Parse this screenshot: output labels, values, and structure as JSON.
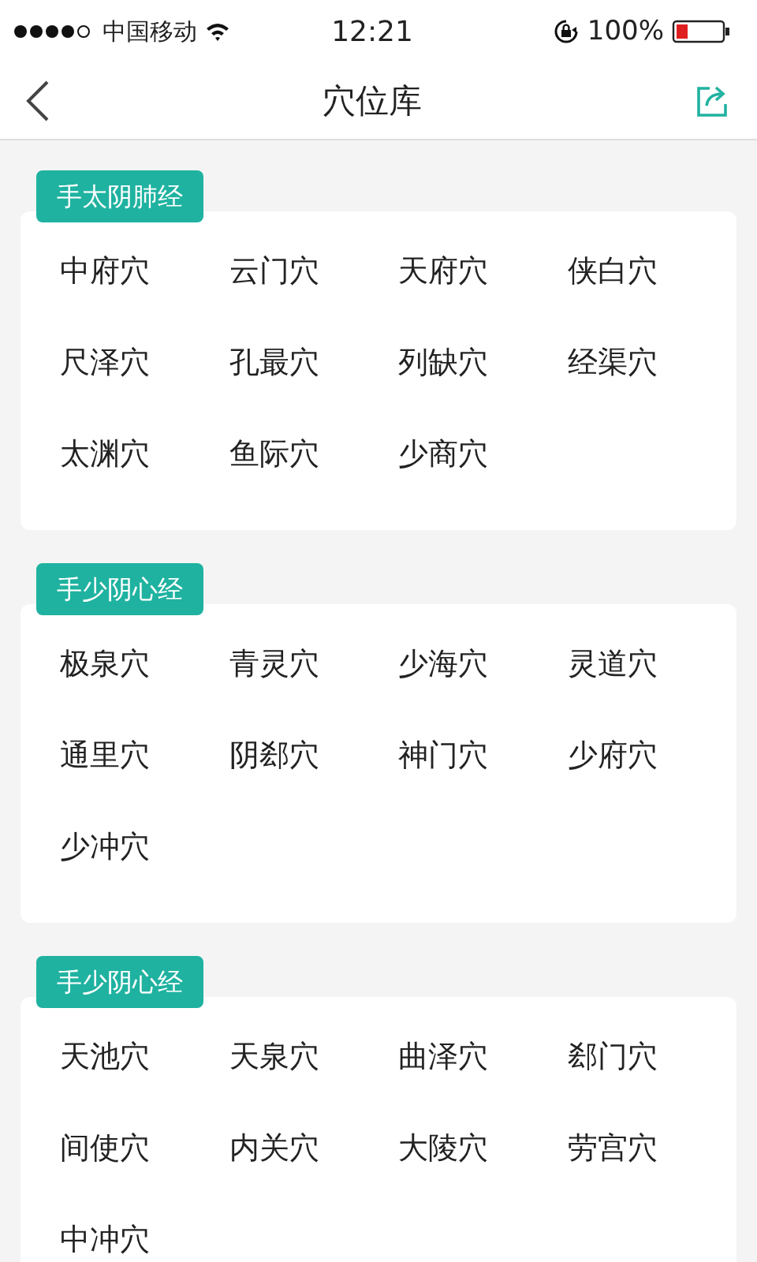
{
  "status_bar": {
    "carrier": "中国移动",
    "time": "12:21",
    "battery": "100%"
  },
  "nav": {
    "title": "穴位库"
  },
  "meridians": [
    {
      "name": "手太阴肺经",
      "points": [
        "中府穴",
        "云门穴",
        "天府穴",
        "侠白穴",
        "尺泽穴",
        "孔最穴",
        "列缺穴",
        "经渠穴",
        "太渊穴",
        "鱼际穴",
        "少商穴"
      ]
    },
    {
      "name": "手少阴心经",
      "points": [
        "极泉穴",
        "青灵穴",
        "少海穴",
        "灵道穴",
        "通里穴",
        "阴郄穴",
        "神门穴",
        "少府穴",
        "少冲穴"
      ]
    },
    {
      "name": "手少阴心经",
      "points": [
        "天池穴",
        "天泉穴",
        "曲泽穴",
        "郄门穴",
        "间使穴",
        "内关穴",
        "大陵穴",
        "劳宫穴",
        "中冲穴"
      ]
    }
  ]
}
